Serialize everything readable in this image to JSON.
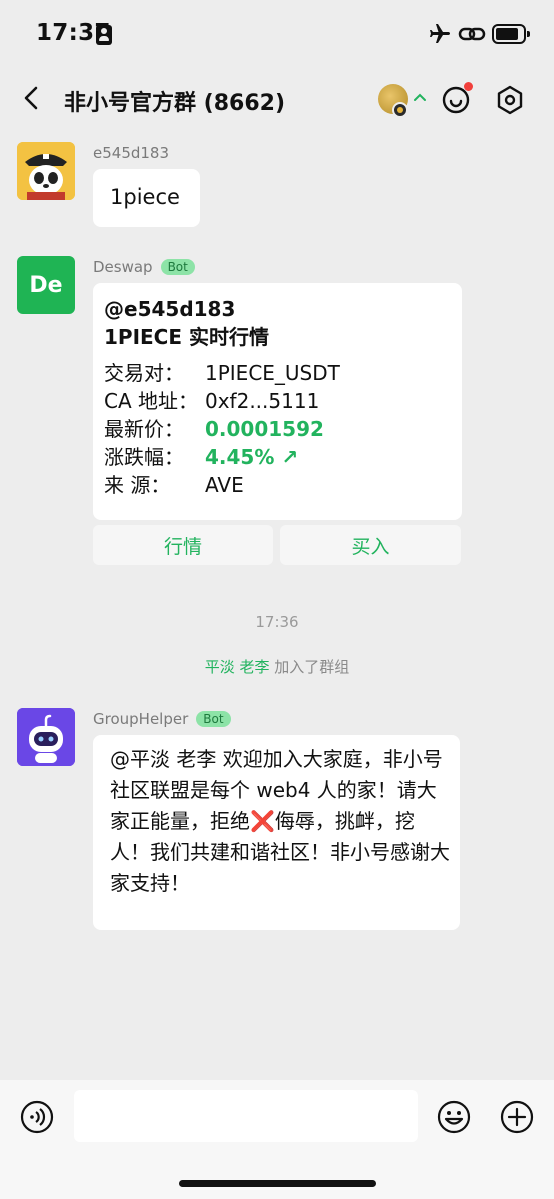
{
  "status_bar": {
    "time": "17:37"
  },
  "nav": {
    "title": "非小号官方群 (8662)"
  },
  "messages": [
    {
      "sender": "e545d183",
      "text": "1piece"
    },
    {
      "sender": "Deswap",
      "tag": "Bot",
      "avatar_text": "De",
      "mention": "@e545d183",
      "heading": "1PIECE 实时行情",
      "rows": [
        {
          "label": "交易对：",
          "value": "1PIECE_USDT"
        },
        {
          "label": "CA 地址：",
          "value": "0xf2...5111"
        },
        {
          "label": "最新价：",
          "value": "0.0001592"
        },
        {
          "label": "涨跌幅：",
          "value": "4.45% ↗"
        },
        {
          "label": "来  源：",
          "value": "AVE"
        }
      ],
      "buttons": [
        "行情",
        "买入"
      ]
    },
    {
      "sender": "GroupHelper",
      "tag": "Bot",
      "text": "@平淡 老李 欢迎加入大家庭，非小号社区联盟是每个 web4 人的家！请大家正能量，拒绝❌侮辱，挑衅，挖人！我们共建和谐社区！非小号感谢大家支持！"
    }
  ],
  "timestamp": "17:36",
  "join_notice": {
    "name": "平淡 老李",
    "text": "加入了群组"
  },
  "colors": {
    "accent_green": "#22b35e",
    "background": "#ededed",
    "bot_tag_bg": "#8de3a7"
  }
}
